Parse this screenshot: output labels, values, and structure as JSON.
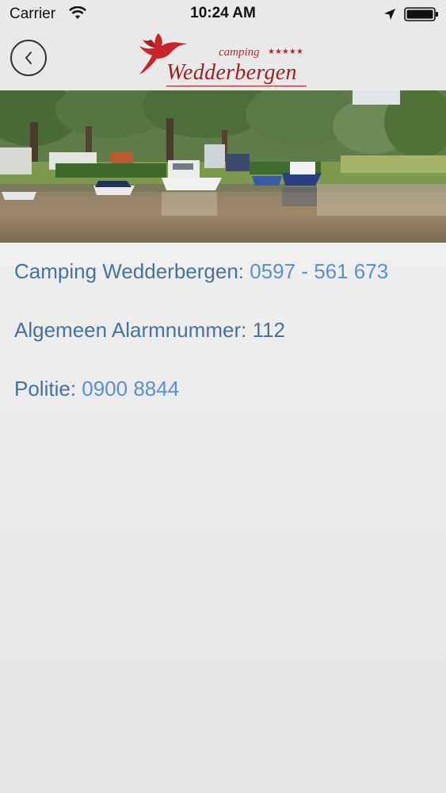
{
  "status_bar": {
    "carrier": "Carrier",
    "time": "10:24 AM",
    "icons": [
      "wifi-icon",
      "location-arrow-icon",
      "battery-icon"
    ]
  },
  "nav": {
    "back_icon": "chevron-left-icon",
    "logo": {
      "small_text": "camping",
      "stars": "★★★★★",
      "name": "Wedderbergen"
    }
  },
  "hero_image": {
    "description_icon": "campsite-photo"
  },
  "contacts": [
    {
      "label": "Camping Wedderbergen:",
      "value": "0597 - 561 673",
      "link": true
    },
    {
      "label": "Algemeen Alarmnummer:",
      "value": "112",
      "link": false
    },
    {
      "label": "Politie:",
      "value": "0900 8844",
      "link": true
    }
  ],
  "colors": {
    "brand_red": "#a11e23",
    "label_blue": "#45729f",
    "link_blue": "#5a90cc",
    "bar_background": "#e9e9e9"
  }
}
